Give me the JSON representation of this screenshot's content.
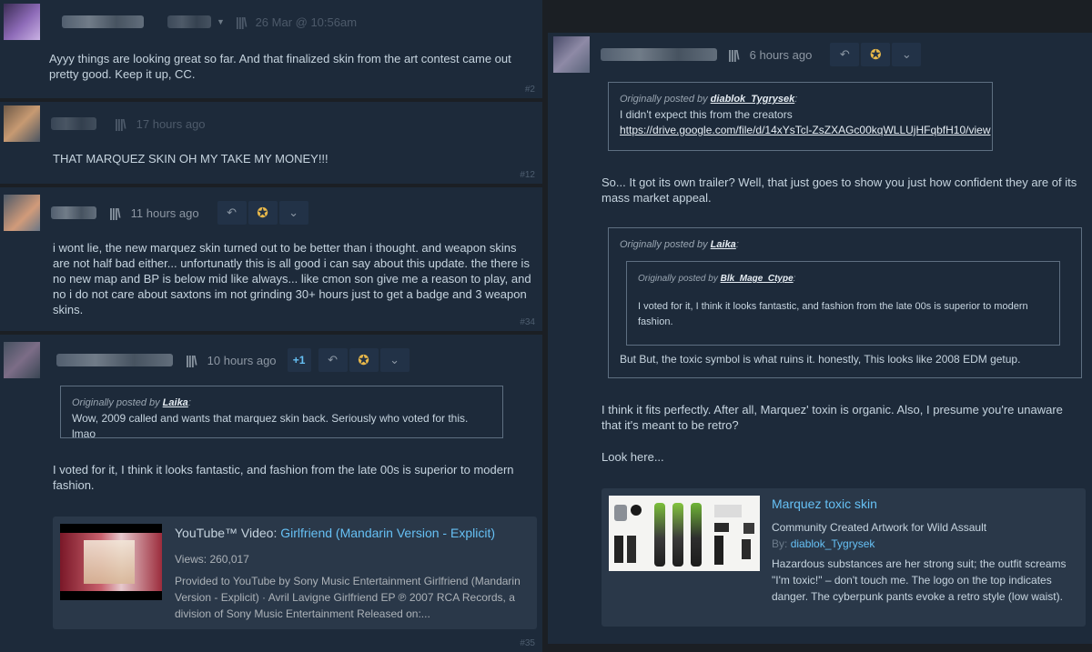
{
  "posts_left": [
    {
      "timestamp": "26 Mar @ 10:56am",
      "body": "Ayyy things are looking great so far. And that finalized skin from the art contest came out pretty good. Keep it up, CC.",
      "number": "#2"
    },
    {
      "timestamp": "17 hours ago",
      "body": "THAT MARQUEZ SKIN OH MY TAKE MY MONEY!!!",
      "number": "#12"
    },
    {
      "timestamp": "11 hours ago",
      "body": "i wont lie, the new marquez skin turned out to be better than i thought. and weapon skins are not half bad either... unfortunatly this is all good i can say about this update. the there is no new map and BP is below mid like always... like cmon son give me a reason to play, and no i do not care about saxtons im not grinding 30+ hours just to get a badge and 3 weapon skins.",
      "number": "#34"
    },
    {
      "timestamp": "10 hours ago",
      "vote_badge": "+1",
      "quote": {
        "prefix": "Originally posted by",
        "author": "Laika",
        "text": "Wow, 2009 called and wants that marquez skin back. Seriously who voted for this. lmao"
      },
      "body": "I voted for it, I think it looks fantastic, and fashion from the late 00s is superior to modern fashion.",
      "embed": {
        "source": "YouTube™ Video:",
        "title": "Girlfriend (Mandarin Version - Explicit)",
        "views": "Views: 260,017",
        "description": "Provided to YouTube by Sony Music Entertainment Girlfriend (Mandarin Version - Explicit) · Avril Lavigne Girlfriend EP ℗ 2007 RCA Records, a division of Sony Music Entertainment Released on:..."
      },
      "number": "#35"
    }
  ],
  "post_right": {
    "timestamp": "6 hours ago",
    "quote1": {
      "prefix": "Originally posted by",
      "author": "diablok_Tygrysek",
      "text": "I didn't expect this from the creators",
      "link": "https://drive.google.com/file/d/14xYsTcl-ZsZXAGc00kqWLLUjHFqbfH10/view"
    },
    "para1": "So... It got its own trailer? Well, that just goes to show you just how confident they are of its mass market appeal.",
    "quote2": {
      "prefix": "Originally posted by",
      "author": "Laika",
      "nested": {
        "prefix": "Originally posted by",
        "author": "Blk_Mage_Ctype",
        "text": "I voted for it, I think it looks fantastic, and fashion from the late 00s is superior to modern fashion."
      },
      "text": "But But, the toxic symbol is what ruins it. honestly, This looks like 2008 EDM getup."
    },
    "para2": "I think it fits perfectly. After all, Marquez' toxin is organic. Also, I presume you're unaware that it's meant to be retro?",
    "para3": "Look here...",
    "artwork": {
      "title": "Marquez toxic skin",
      "subtitle": "Community Created Artwork for Wild Assault",
      "by_prefix": "By:",
      "by_author": "diablok_Tygrysek",
      "description": "Hazardous substances are her strong suit; the outfit screams \"I'm toxic!\" – don't touch me. The logo on the top indicates danger. The cyberpunk pants evoke a retro style (low waist)."
    }
  },
  "icons": {
    "rate_up": "award-icon",
    "reply": "reply-icon",
    "more": "chevron-down-icon",
    "books": "library-icon"
  },
  "colors": {
    "background": "#1b1f24",
    "post_bg": "#1d2a3a",
    "link_blue": "#66c0f4",
    "award_gold": "#e8b84a"
  }
}
